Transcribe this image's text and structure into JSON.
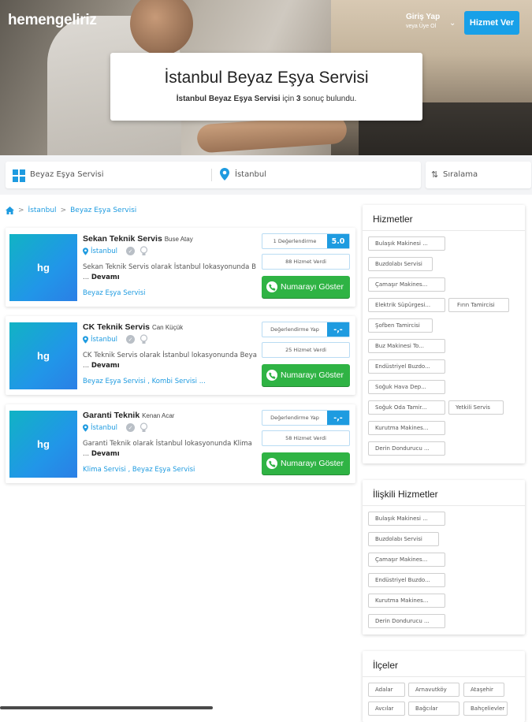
{
  "header": {
    "logo": "hemengeliriz",
    "login_title": "Giriş Yap",
    "login_sub": "veya Üye Ol",
    "cta": "Hizmet Ver"
  },
  "hero": {
    "title": "İstanbul Beyaz Eşya Servisi",
    "subtitle_bold": "İstanbul Beyaz Eşya Servisi",
    "subtitle_mid": " için ",
    "subtitle_count": "3",
    "subtitle_end": " sonuç bulundu."
  },
  "search": {
    "category": "Beyaz Eşya Servisi",
    "city": "İstanbul",
    "sort": "Sıralama"
  },
  "breadcrumb": {
    "items": [
      "İstanbul",
      "Beyaz Eşya Servisi"
    ]
  },
  "listings": [
    {
      "thumb": "hg",
      "name": "Sekan Teknik Servis",
      "owner": "Buse Atay",
      "location": "İstanbul",
      "desc": "Sekan Teknik Servis olarak İstanbul lokasyonunda B ... ",
      "more": "Devamı",
      "tags": "Beyaz Eşya Servisi",
      "rating_label": "1 Değerlendirme",
      "rating_value": "5.0",
      "served": "88 Hizmet Verdi",
      "call": "Numarayı Göster"
    },
    {
      "thumb": "hg",
      "name": "CK Teknik Servis",
      "owner": "Can Küçük",
      "location": "İstanbul",
      "desc": "CK Teknik Servis olarak İstanbul lokasyonunda Beya ... ",
      "more": "Devamı",
      "tags": "Beyaz Eşya Servisi ,  Kombi Servisi ...",
      "rating_label": "Değerlendirme Yap",
      "rating_value": "-,-",
      "served": "25 Hizmet Verdi",
      "call": "Numarayı Göster"
    },
    {
      "thumb": "hg",
      "name": "Garanti Teknik",
      "owner": "Kenan Acar",
      "location": "İstanbul",
      "desc": "Garanti Teknik olarak İstanbul lokasyonunda Klima ... ",
      "more": "Devamı",
      "tags": "Klima Servisi ,  Beyaz Eşya Servisi",
      "rating_label": "Değerlendirme Yap",
      "rating_value": "-,-",
      "served": "58 Hizmet Verdi",
      "call": "Numarayı Göster"
    }
  ],
  "sidebar": {
    "services": {
      "title": "Hizmetler",
      "items": [
        "Bulaşık Makinesi ...",
        "Buzdolabı Servisi",
        "Çamaşır Makines...",
        "Elektrik Süpürgesi...",
        "Fırın Tamircisi",
        "Şofben Tamircisi",
        "Buz Makinesi To...",
        "Endüstriyel Buzdo...",
        "Soğuk Hava Dep...",
        "Soğuk Oda Tamir...",
        "Yetkili Servis",
        "Kurutma Makines...",
        "Derin Dondurucu ..."
      ]
    },
    "related": {
      "title": "İlişkili Hizmetler",
      "items": [
        "Bulaşık Makinesi ...",
        "Buzdolabı Servisi",
        "Çamaşır Makines...",
        "Endüstriyel Buzdo...",
        "Kurutma Makines...",
        "Derin Dondurucu ..."
      ]
    },
    "districts": {
      "title": "İlçeler",
      "items": [
        "Adalar",
        "Arnavutköy",
        "Ataşehir",
        "Avcılar",
        "Bağcılar",
        "Bahçelievler"
      ]
    }
  },
  "colors": {
    "accent": "#1e9be0",
    "call": "#2fb344"
  }
}
